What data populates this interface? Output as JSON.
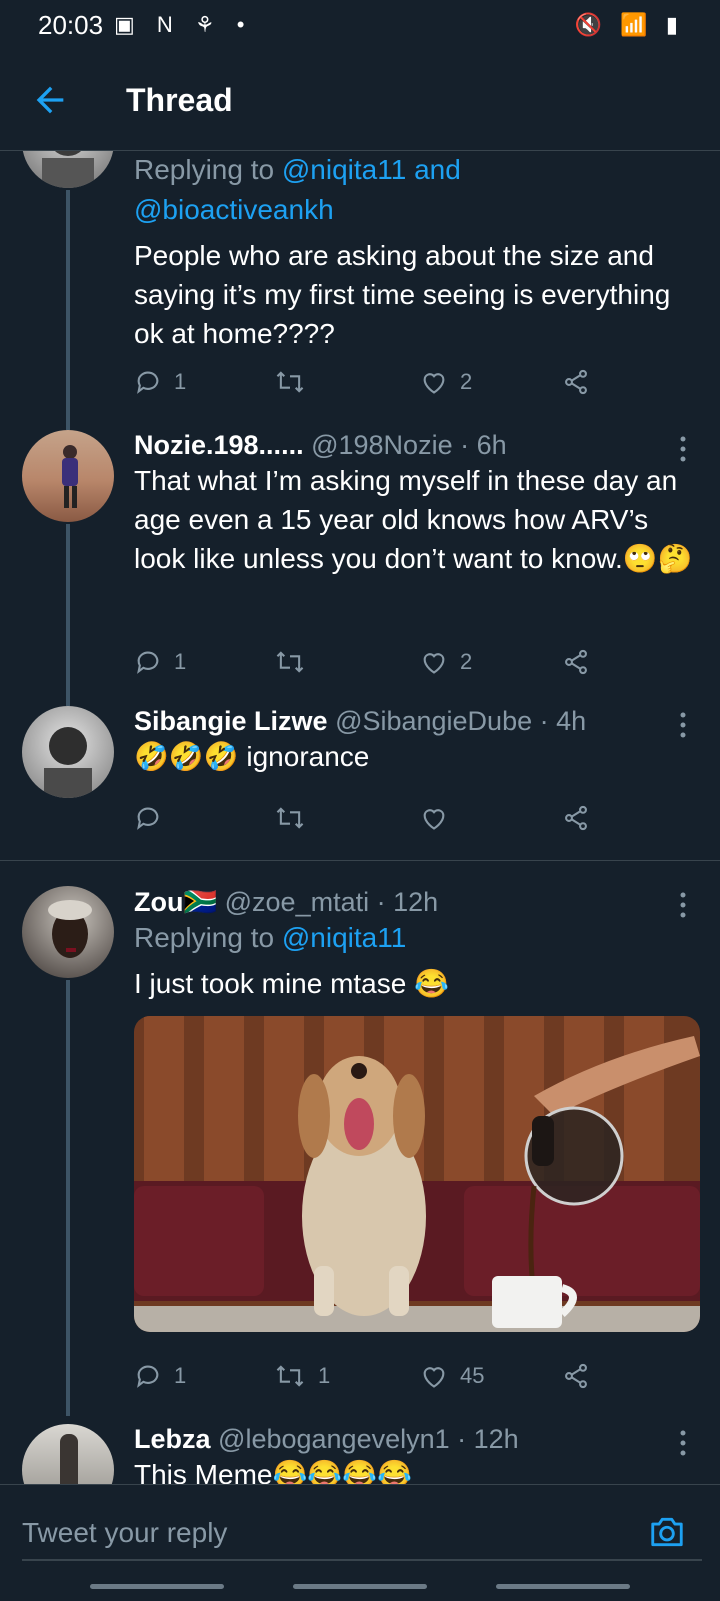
{
  "status": {
    "time": "20:03",
    "left_icons": "▣ N ⚘ •",
    "right_icons": "🔇 📶 ▮"
  },
  "header": {
    "title": "Thread"
  },
  "colors": {
    "background": "#15202b",
    "accent": "#1da1f2",
    "muted": "#8899a6",
    "divider": "#38444d"
  },
  "tweets": [
    {
      "replying_prefix": "Replying to",
      "mention1": "@niqita11",
      "and": " and",
      "mention2": "@bioactiveankh",
      "text": "People who are asking about the size and saying it’s my first time seeing is everything ok at home????",
      "replies": "1",
      "retweets": "",
      "likes": "2"
    },
    {
      "name": "Nozie.198......",
      "handle": "@198Nozie",
      "time": "· 6h",
      "text": "That what I’m asking myself in these day an age even a 15 year old knows how ARV’s look like unless you don’t want to know.",
      "emojis": "🙄🤔",
      "replies": "1",
      "retweets": "",
      "likes": "2"
    },
    {
      "name": "Sibangie Lizwe",
      "handle": "@SibangieDube",
      "time": "· 4h",
      "text": "ignorance",
      "emojis": "🤣🤣🤣",
      "replies": "",
      "retweets": "",
      "likes": ""
    },
    {
      "name": "Zou",
      "flag": "🇿🇦",
      "handle": "@zoe_mtati",
      "time": "· 12h",
      "replying_prefix": "Replying to",
      "mention1": "@niqita11",
      "text": "I just took mine mtase",
      "emojis": "😂",
      "replies": "1",
      "retweets": "1",
      "likes": "45"
    },
    {
      "name": "Lebza",
      "handle": "@lebogangevelyn1",
      "time": "· 12h",
      "text": "This Meme",
      "emojis": "😂😂😂😂"
    }
  ],
  "reply": {
    "placeholder": "Tweet your reply"
  },
  "icons": [
    "back-arrow-icon",
    "reply-icon",
    "retweet-icon",
    "like-icon",
    "share-icon",
    "more-icon",
    "camera-icon"
  ]
}
